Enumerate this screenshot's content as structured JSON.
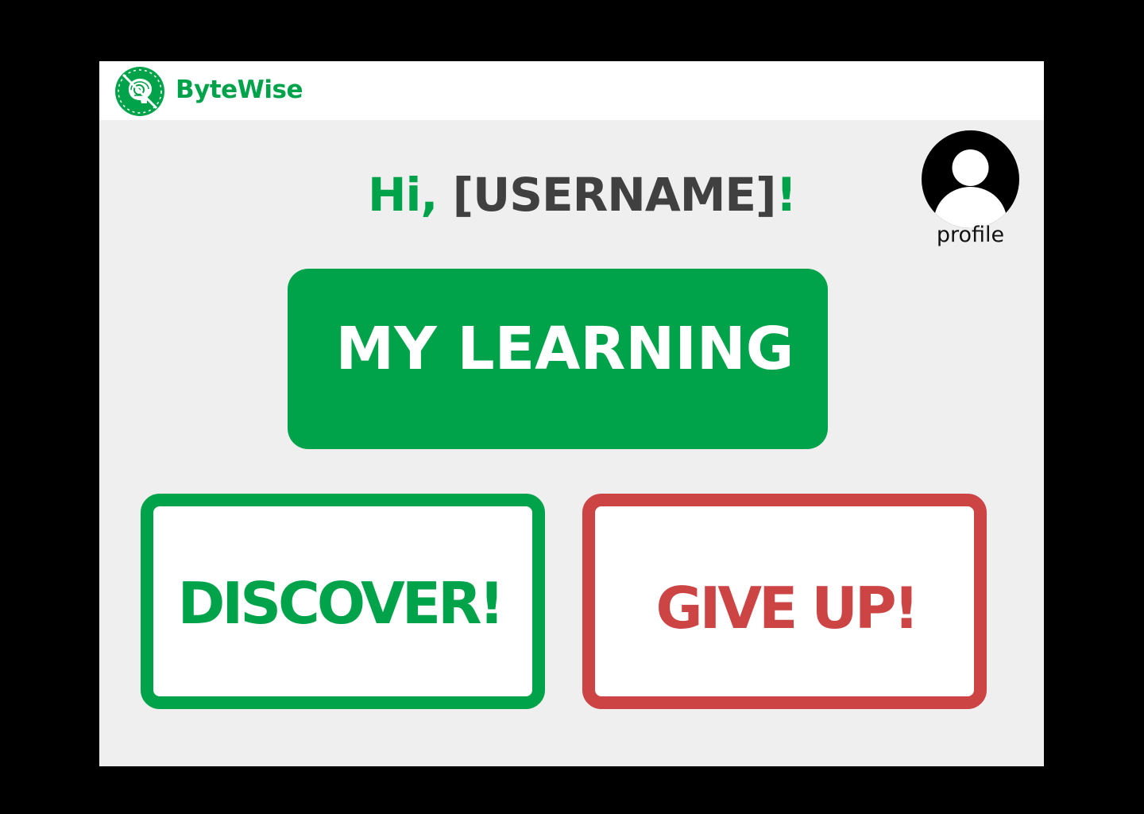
{
  "app": {
    "brand_name": "ByteWise",
    "logo_icon": "brain-logo-icon"
  },
  "greeting": {
    "prefix": "Hi, ",
    "username": "[USERNAME]",
    "suffix": "!"
  },
  "profile": {
    "label": "profile",
    "icon": "user-avatar-icon"
  },
  "actions": {
    "my_learning": "MY LEARNING",
    "discover": "DISCOVER!",
    "give_up": "GIVE UP!"
  },
  "colors": {
    "brand_green": "#00a34a",
    "danger_red": "#cc4444",
    "text_gray": "#404040",
    "background": "#efefef"
  }
}
